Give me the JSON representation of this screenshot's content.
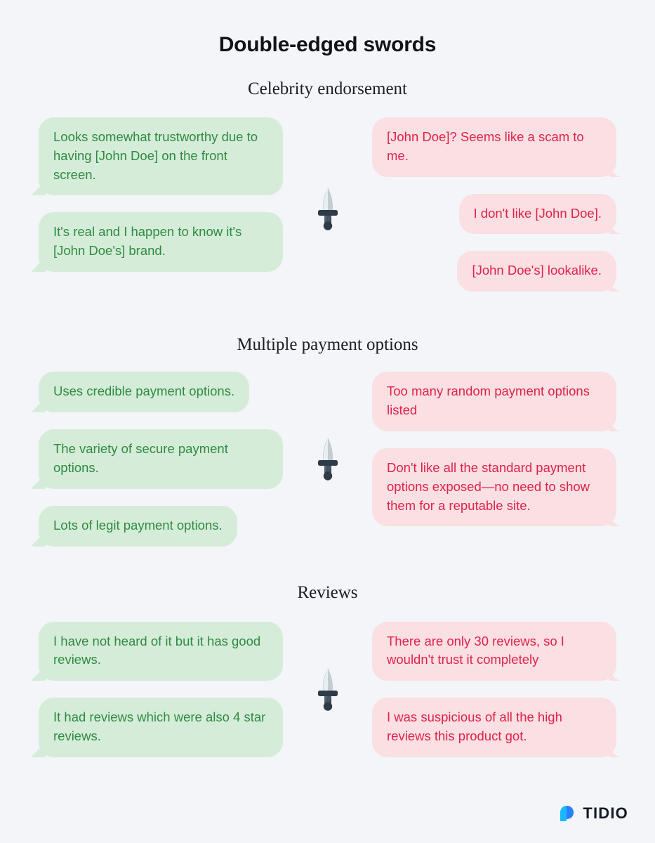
{
  "header": {
    "title": "Double-edged swords"
  },
  "colors": {
    "background": "#f4f5f8",
    "positive_bubble_bg": "#d5ecd9",
    "positive_bubble_text": "#2e8b41",
    "negative_bubble_bg": "#fadfe3",
    "negative_bubble_text": "#e0224a",
    "title_text": "#111317",
    "brand_blue": "#2b7fff",
    "brand_cyan": "#1bb9ff"
  },
  "sections": [
    {
      "heading": "Celebrity endorsement",
      "divider_icon": "dagger-icon",
      "positive": [
        "Looks somewhat trustworthy due to having [John Doe] on the front screen.",
        "It's real and I happen to know it's [John Doe's] brand."
      ],
      "negative": [
        "[John Doe]? Seems like a scam to me.",
        "I don't like [John Doe].",
        "[John Doe's] lookalike."
      ]
    },
    {
      "heading": "Multiple payment options",
      "divider_icon": "dagger-icon",
      "positive": [
        "Uses credible payment options.",
        "The variety of secure payment options.",
        "Lots of legit payment options."
      ],
      "negative": [
        "Too many random payment options listed",
        "Don't like all the standard payment options exposed—no need to show them for a reputable site."
      ]
    },
    {
      "heading": "Reviews",
      "divider_icon": "dagger-icon",
      "positive": [
        "I have not heard of it but it has good reviews.",
        "It had reviews which were also 4 star reviews."
      ],
      "negative": [
        "There are only 30 reviews, so I wouldn't trust it completely",
        "I was suspicious of all the high reviews this product got."
      ]
    }
  ],
  "footer": {
    "brand_name": "TIDIO",
    "brand_icon": "tidio-logo-icon"
  }
}
